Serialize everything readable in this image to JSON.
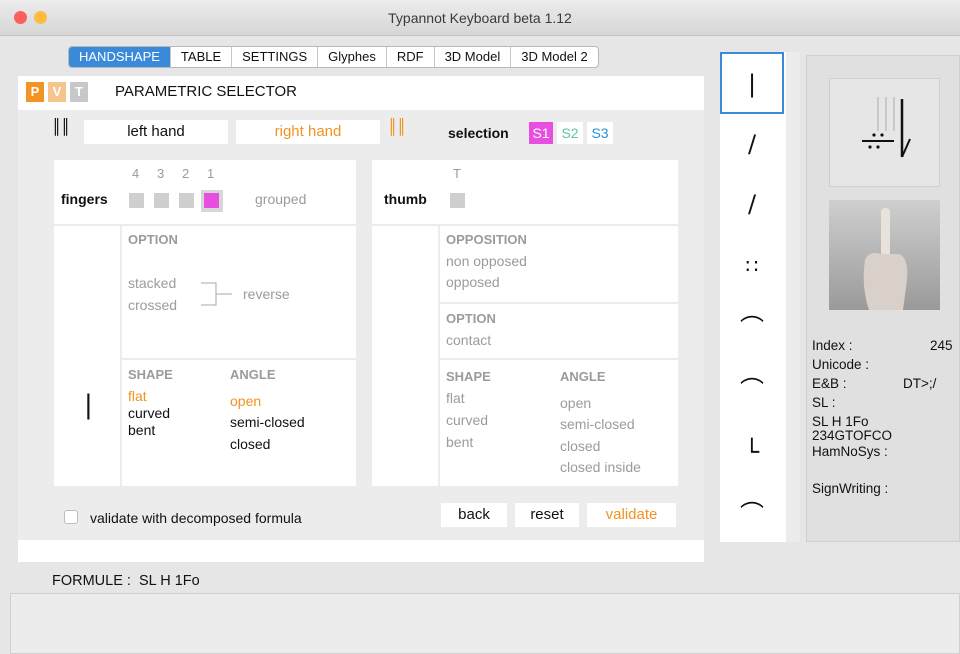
{
  "window": {
    "title": "Typannot Keyboard beta 1.12"
  },
  "tabs": [
    {
      "label": "HANDSHAPE"
    },
    {
      "label": "TABLE"
    },
    {
      "label": "SETTINGS"
    },
    {
      "label": "Glyphes"
    },
    {
      "label": "RDF"
    },
    {
      "label": "3D Model"
    },
    {
      "label": "3D Model 2"
    }
  ],
  "selector": {
    "p": "P",
    "v": "V",
    "t": "T",
    "title": "PARAMETRIC SELECTOR"
  },
  "hands": {
    "left_glyph": "║║",
    "left": "left hand",
    "right": "right hand",
    "right_glyph": "║║",
    "selection": "selection",
    "s1": "S1",
    "s2": "S2",
    "s3": "S3"
  },
  "fingers": {
    "label": "fingers",
    "nums": [
      "4",
      "3",
      "2",
      "1"
    ],
    "grouped": "grouped",
    "glyph": "|",
    "option_title": "OPTION",
    "stacked": "stacked",
    "crossed": "crossed",
    "reverse": "reverse",
    "shape_title": "SHAPE",
    "angle_title": "ANGLE",
    "shapes": [
      "flat",
      "curved",
      "bent"
    ],
    "angles": [
      "open",
      "semi-closed",
      "closed"
    ]
  },
  "thumb": {
    "label": "thumb",
    "t": "T",
    "opposition_title": "OPPOSITION",
    "non_opposed": "non opposed",
    "opposed": "opposed",
    "option_title": "OPTION",
    "contact": "contact",
    "shape_title": "SHAPE",
    "angle_title": "ANGLE",
    "shapes": [
      "flat",
      "curved",
      "bent"
    ],
    "angles": [
      "open",
      "semi-closed",
      "closed",
      "closed inside"
    ]
  },
  "footer": {
    "validate_cb": "validate with decomposed formula",
    "back": "back",
    "reset": "reset",
    "validate": "validate",
    "formule": "FORMULE :  SL H 1Fo"
  },
  "glyphs": [
    "|",
    "∕",
    "∕",
    "∷",
    "⌒",
    "⌒",
    "└",
    "⌒"
  ],
  "info": {
    "index_label": "Index :",
    "index_val": "245",
    "unicode": "Unicode :",
    "eb_label": "E&B :",
    "eb_val": "DT>;/",
    "sl": "SL :",
    "sl_val1": "SL H 1Fo",
    "sl_val2": "234GTOFCO",
    "hamnosys": "HamNoSys :",
    "signwriting": "SignWriting :"
  },
  "colors": {
    "accent": "#3b8ad9",
    "orange": "#f29322",
    "magenta": "#e84fe0",
    "green": "#5fc4a4",
    "blue": "#2a8fd6"
  }
}
